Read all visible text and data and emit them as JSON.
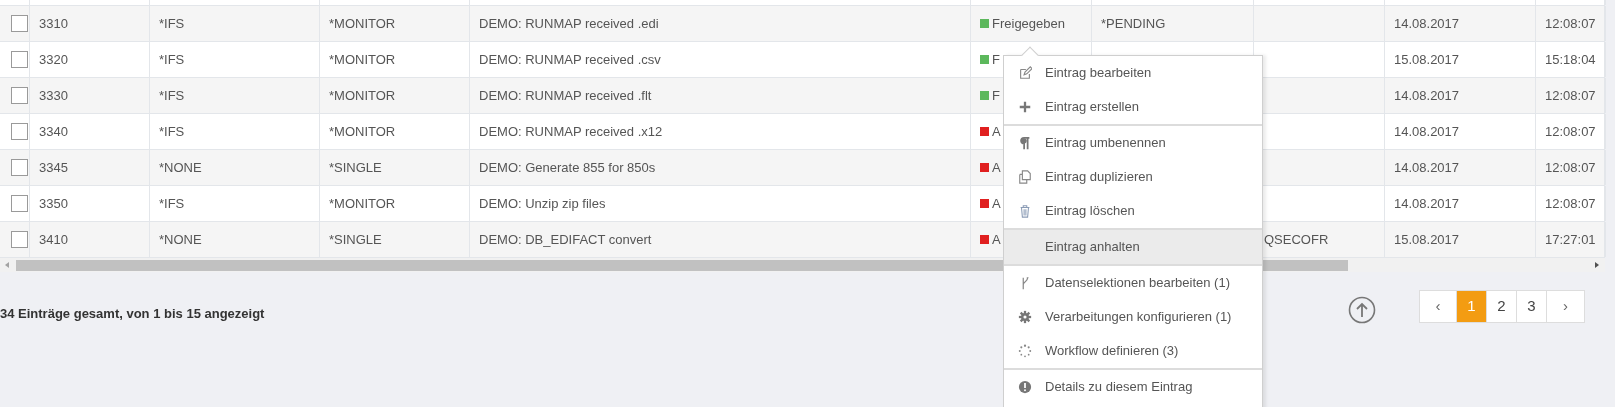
{
  "table": {
    "rows": [
      {
        "checked": false,
        "id": "3310",
        "type": "*IFS",
        "mode": "*MONITOR",
        "description": "DEMO: RUNMAP received .edi",
        "status": {
          "text": "Freigegeben",
          "color": "#5cb85c"
        },
        "column_7": "*PENDING",
        "column_8": "",
        "date": "14.08.2017",
        "time": "12:08:07"
      },
      {
        "checked": false,
        "id": "3320",
        "type": "*IFS",
        "mode": "*MONITOR",
        "description": "DEMO: RUNMAP received .csv",
        "status": {
          "text": "F",
          "color": "#5cb85c"
        },
        "column_7": "",
        "column_8": "",
        "date": "15.08.2017",
        "time": "15:18:04"
      },
      {
        "checked": false,
        "id": "3330",
        "type": "*IFS",
        "mode": "*MONITOR",
        "description": "DEMO: RUNMAP received .flt",
        "status": {
          "text": "F",
          "color": "#5cb85c"
        },
        "column_7": "",
        "column_8": "",
        "date": "14.08.2017",
        "time": "12:08:07"
      },
      {
        "checked": false,
        "id": "3340",
        "type": "*IFS",
        "mode": "*MONITOR",
        "description": "DEMO: RUNMAP received .x12",
        "status": {
          "text": "A",
          "color": "#e02020"
        },
        "column_7": "",
        "column_8": "",
        "date": "14.08.2017",
        "time": "12:08:07"
      },
      {
        "checked": false,
        "id": "3345",
        "type": "*NONE",
        "mode": "*SINGLE",
        "description": "DEMO: Generate 855 for 850s",
        "status": {
          "text": "A",
          "color": "#e02020"
        },
        "column_7": "",
        "column_8": "",
        "date": "14.08.2017",
        "time": "12:08:07"
      },
      {
        "checked": false,
        "id": "3350",
        "type": "*IFS",
        "mode": "*MONITOR",
        "description": "DEMO: Unzip zip files",
        "status": {
          "text": "A",
          "color": "#e02020"
        },
        "column_7": "",
        "column_8": "",
        "date": "14.08.2017",
        "time": "12:08:07"
      },
      {
        "checked": false,
        "id": "3410",
        "type": "*NONE",
        "mode": "*SINGLE",
        "description": "DEMO: DB_EDIFACT convert",
        "status": {
          "text": "A",
          "color": "#e02020"
        },
        "column_7": "",
        "column_8": "QSECOFR",
        "date": "15.08.2017",
        "time": "17:27:01"
      }
    ]
  },
  "footer": {
    "summary": "34 Einträge gesamt, von 1 bis 15 angezeigt"
  },
  "pagination": {
    "pages": [
      {
        "label": "1",
        "selected": true
      },
      {
        "label": "2",
        "selected": false
      },
      {
        "label": "3",
        "selected": false
      }
    ],
    "prev": "‹",
    "next": "›"
  },
  "context_menu": {
    "groups": [
      [
        {
          "label": "Eintrag bearbeiten",
          "selected": false
        },
        {
          "label": "Eintrag erstellen",
          "selected": false
        }
      ],
      [
        {
          "label": "Eintrag umbenennen",
          "selected": false
        },
        {
          "label": "Eintrag duplizieren",
          "selected": false
        },
        {
          "label": "Eintrag löschen",
          "selected": false
        }
      ],
      [
        {
          "label": "Eintrag anhalten",
          "selected": true
        }
      ],
      [
        {
          "label": "Datenselektionen bearbeiten (1)",
          "selected": false
        },
        {
          "label": "Verarbeitungen konfigurieren (1)",
          "selected": false
        },
        {
          "label": "Workflow definieren (3)",
          "selected": false
        }
      ],
      [
        {
          "label": "Details zu diesem Eintrag",
          "selected": false
        }
      ]
    ]
  }
}
